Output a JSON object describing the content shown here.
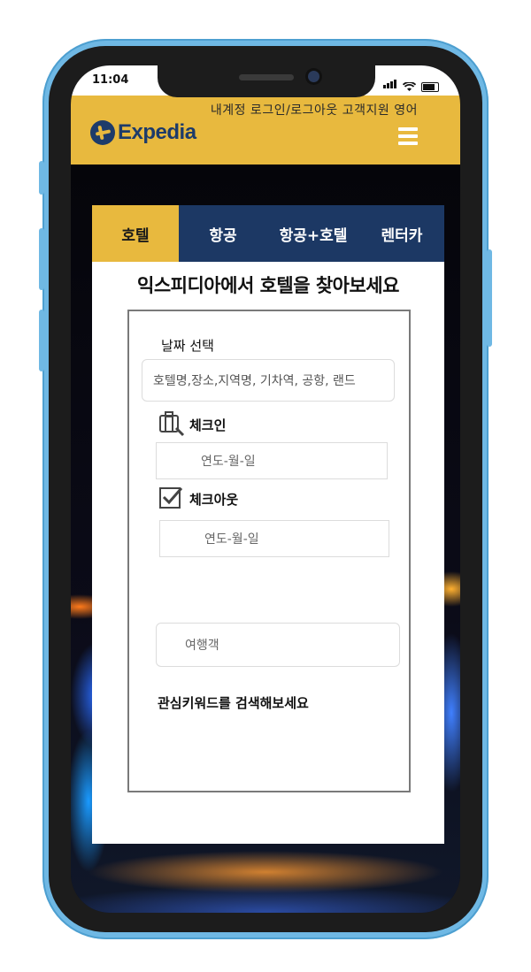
{
  "status_bar": {
    "time": "11:04"
  },
  "header": {
    "top_links": "내계정 로그인/로그아웃 고객지원 영어",
    "logo_text": "Expedia",
    "brand_color": "#e8b93e",
    "logo_color": "#1d3b6a"
  },
  "tabs": [
    {
      "label": "호텔",
      "active": true
    },
    {
      "label": "항공",
      "active": false
    },
    {
      "label": "항공+호텔",
      "active": false
    },
    {
      "label": "렌터카",
      "active": false
    }
  ],
  "search": {
    "headline": "익스피디아에서 호텔을 찾아보세요",
    "date_label": "날짜 선택",
    "location_placeholder": "호텔명,장소,지역명, 기차역, 공항, 랜드",
    "checkin_label": "체크인",
    "checkin_placeholder": "연도-월-일",
    "checkout_label": "체크아웃",
    "checkout_placeholder": "연도-월-일",
    "travelers_placeholder": "여행객",
    "keyword_label": "관심키워드를 검색해보세요"
  },
  "icons": {
    "checkin": "luggage-icon",
    "checkout": "checkbox-checked-icon",
    "menu": "hamburger-menu-icon"
  }
}
